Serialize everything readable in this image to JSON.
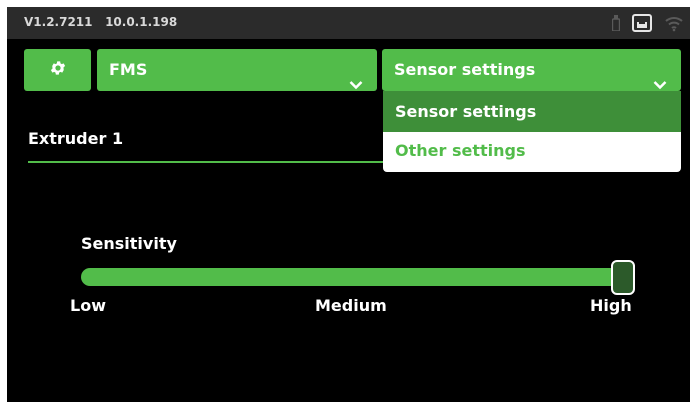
{
  "status_bar": {
    "version": "V1.2.7211",
    "ip": "10.0.1.198",
    "icons": [
      "usb-icon",
      "ethernet-icon",
      "wifi-icon"
    ]
  },
  "header": {
    "settings_icon": "gear-icon",
    "fms_dropdown": {
      "selected": "FMS"
    },
    "mode_dropdown": {
      "selected": "Sensor settings"
    }
  },
  "mode_menu": {
    "items": [
      {
        "label": "Sensor settings",
        "selected": true
      },
      {
        "label": "Other settings",
        "selected": false
      }
    ]
  },
  "tab": {
    "label": "Extruder 1"
  },
  "sensitivity": {
    "label": "Sensitivity",
    "value_fraction": 1.0,
    "ticks": [
      "Low",
      "Medium",
      "High"
    ]
  },
  "colors": {
    "accent": "#52bc4a",
    "accent_dark": "#3e8f39",
    "background": "#000000",
    "status_bar": "#2b2b2b"
  }
}
